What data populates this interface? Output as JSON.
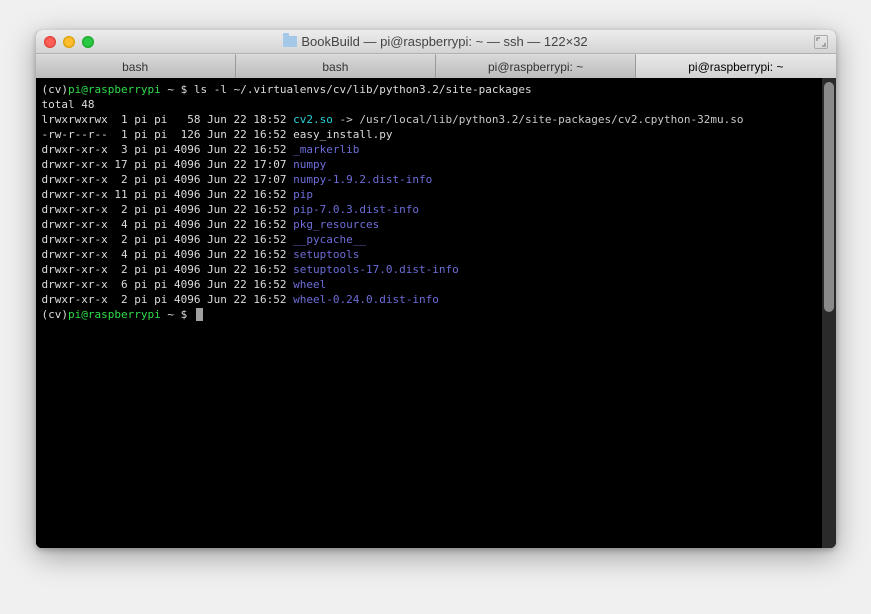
{
  "window": {
    "title": "BookBuild — pi@raspberrypi: ~ — ssh — 122×32"
  },
  "tabs": [
    {
      "label": "bash",
      "active": false
    },
    {
      "label": "bash",
      "active": false
    },
    {
      "label": "pi@raspberrypi: ~",
      "active": false
    },
    {
      "label": "pi@raspberrypi: ~",
      "active": true
    }
  ],
  "prompt": {
    "prefix": "(cv)",
    "userhost": "pi@raspberrypi",
    "path": " ~ $ "
  },
  "command": "ls -l ~/.virtualenvs/cv/lib/python3.2/site-packages",
  "total_line": "total 48",
  "listing": [
    {
      "perm": "lrwxrwxrwx",
      "n": "1",
      "own": "pi pi",
      "size": "58",
      "date": "Jun 22 18:52",
      "name": "cv2.so",
      "type": "link",
      "target": " -> /usr/local/lib/python3.2/site-packages/cv2.cpython-32mu.so"
    },
    {
      "perm": "-rw-r--r--",
      "n": "1",
      "own": "pi pi",
      "size": "126",
      "date": "Jun 22 16:52",
      "name": "easy_install.py",
      "type": "file"
    },
    {
      "perm": "drwxr-xr-x",
      "n": "3",
      "own": "pi pi",
      "size": "4096",
      "date": "Jun 22 16:52",
      "name": "_markerlib",
      "type": "dir"
    },
    {
      "perm": "drwxr-xr-x",
      "n": "17",
      "own": "pi pi",
      "size": "4096",
      "date": "Jun 22 17:07",
      "name": "numpy",
      "type": "dir"
    },
    {
      "perm": "drwxr-xr-x",
      "n": "2",
      "own": "pi pi",
      "size": "4096",
      "date": "Jun 22 17:07",
      "name": "numpy-1.9.2.dist-info",
      "type": "dir"
    },
    {
      "perm": "drwxr-xr-x",
      "n": "11",
      "own": "pi pi",
      "size": "4096",
      "date": "Jun 22 16:52",
      "name": "pip",
      "type": "dir"
    },
    {
      "perm": "drwxr-xr-x",
      "n": "2",
      "own": "pi pi",
      "size": "4096",
      "date": "Jun 22 16:52",
      "name": "pip-7.0.3.dist-info",
      "type": "dir"
    },
    {
      "perm": "drwxr-xr-x",
      "n": "4",
      "own": "pi pi",
      "size": "4096",
      "date": "Jun 22 16:52",
      "name": "pkg_resources",
      "type": "dir"
    },
    {
      "perm": "drwxr-xr-x",
      "n": "2",
      "own": "pi pi",
      "size": "4096",
      "date": "Jun 22 16:52",
      "name": "__pycache__",
      "type": "dir"
    },
    {
      "perm": "drwxr-xr-x",
      "n": "4",
      "own": "pi pi",
      "size": "4096",
      "date": "Jun 22 16:52",
      "name": "setuptools",
      "type": "dir"
    },
    {
      "perm": "drwxr-xr-x",
      "n": "2",
      "own": "pi pi",
      "size": "4096",
      "date": "Jun 22 16:52",
      "name": "setuptools-17.0.dist-info",
      "type": "dir"
    },
    {
      "perm": "drwxr-xr-x",
      "n": "6",
      "own": "pi pi",
      "size": "4096",
      "date": "Jun 22 16:52",
      "name": "wheel",
      "type": "dir"
    },
    {
      "perm": "drwxr-xr-x",
      "n": "2",
      "own": "pi pi",
      "size": "4096",
      "date": "Jun 22 16:52",
      "name": "wheel-0.24.0.dist-info",
      "type": "dir"
    }
  ]
}
